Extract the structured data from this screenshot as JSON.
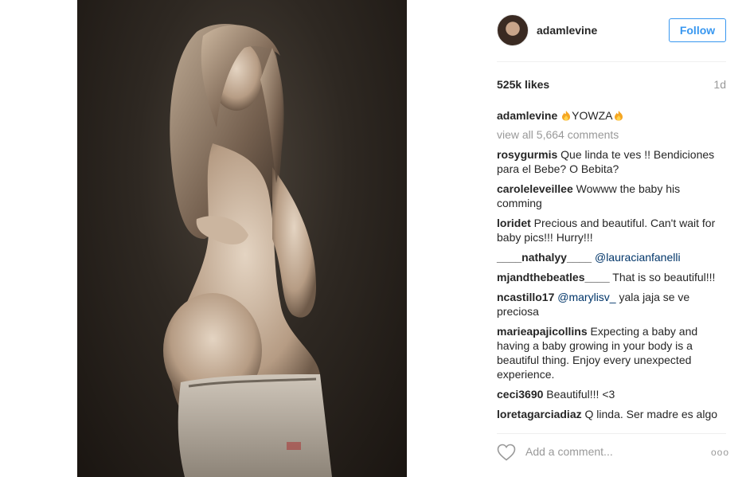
{
  "post": {
    "author": "adamlevine",
    "follow_label": "Follow",
    "likes": "525k likes",
    "age": "1d",
    "caption": {
      "user": "adamlevine",
      "text": "YOWZA"
    },
    "view_all": "view all 5,664 comments",
    "comments": [
      {
        "user": "rosygurmis",
        "text": "Que linda te ves !! Bendiciones para el Bebe? O Bebita?"
      },
      {
        "user": "caroleleveillee",
        "text": "Wowww the baby his comming"
      },
      {
        "user": "loridet",
        "text": "Precious and beautiful. Can't wait for baby pics!!! Hurry!!!"
      },
      {
        "user": "____nathalyy____",
        "mention": "@lauracianfanelli",
        "text": ""
      },
      {
        "user": "mjandthebeatles____",
        "text": "That is so beautiful!!!"
      },
      {
        "user": "ncastillo17",
        "mention": "@marylisv_",
        "text": "yala jaja se ve preciosa"
      },
      {
        "user": "marieapajicollins",
        "text": "Expecting a baby and having a baby growing in your body is a beautiful thing. Enjoy every unexpected experience."
      },
      {
        "user": "ceci3690",
        "text": "Beautiful!!! <3"
      },
      {
        "user": "loretagarciadiaz",
        "text": "Q linda. Ser madre es algo"
      }
    ],
    "add_comment_placeholder": "Add a comment...",
    "more_label": "ooo"
  },
  "icons": {
    "caption_emoji": "fire-emoji-icon",
    "like": "heart-icon",
    "more": "more-options-icon"
  },
  "colors": {
    "accent": "#3897f0",
    "mention": "#003569",
    "muted": "#999999"
  }
}
